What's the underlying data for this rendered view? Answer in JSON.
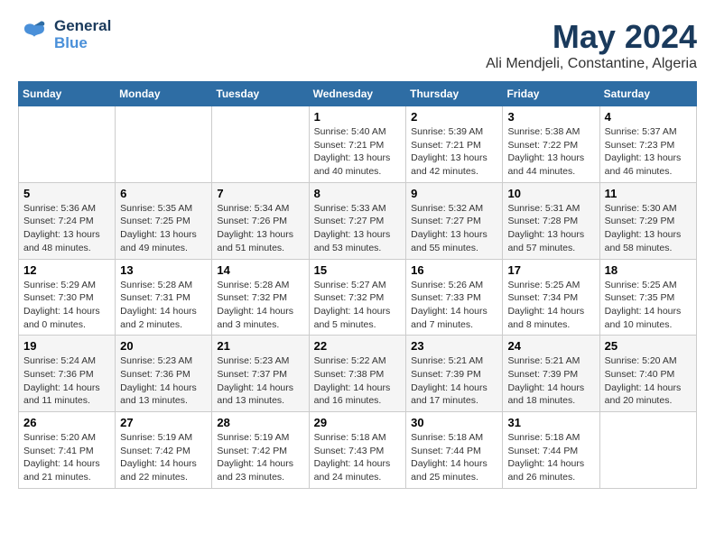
{
  "header": {
    "logo": {
      "general": "General",
      "blue": "Blue"
    },
    "month": "May 2024",
    "location": "Ali Mendjeli, Constantine, Algeria"
  },
  "weekdays": [
    "Sunday",
    "Monday",
    "Tuesday",
    "Wednesday",
    "Thursday",
    "Friday",
    "Saturday"
  ],
  "weeks": [
    [
      {
        "day": "",
        "info": ""
      },
      {
        "day": "",
        "info": ""
      },
      {
        "day": "",
        "info": ""
      },
      {
        "day": "1",
        "info": "Sunrise: 5:40 AM\nSunset: 7:21 PM\nDaylight: 13 hours\nand 40 minutes."
      },
      {
        "day": "2",
        "info": "Sunrise: 5:39 AM\nSunset: 7:21 PM\nDaylight: 13 hours\nand 42 minutes."
      },
      {
        "day": "3",
        "info": "Sunrise: 5:38 AM\nSunset: 7:22 PM\nDaylight: 13 hours\nand 44 minutes."
      },
      {
        "day": "4",
        "info": "Sunrise: 5:37 AM\nSunset: 7:23 PM\nDaylight: 13 hours\nand 46 minutes."
      }
    ],
    [
      {
        "day": "5",
        "info": "Sunrise: 5:36 AM\nSunset: 7:24 PM\nDaylight: 13 hours\nand 48 minutes."
      },
      {
        "day": "6",
        "info": "Sunrise: 5:35 AM\nSunset: 7:25 PM\nDaylight: 13 hours\nand 49 minutes."
      },
      {
        "day": "7",
        "info": "Sunrise: 5:34 AM\nSunset: 7:26 PM\nDaylight: 13 hours\nand 51 minutes."
      },
      {
        "day": "8",
        "info": "Sunrise: 5:33 AM\nSunset: 7:27 PM\nDaylight: 13 hours\nand 53 minutes."
      },
      {
        "day": "9",
        "info": "Sunrise: 5:32 AM\nSunset: 7:27 PM\nDaylight: 13 hours\nand 55 minutes."
      },
      {
        "day": "10",
        "info": "Sunrise: 5:31 AM\nSunset: 7:28 PM\nDaylight: 13 hours\nand 57 minutes."
      },
      {
        "day": "11",
        "info": "Sunrise: 5:30 AM\nSunset: 7:29 PM\nDaylight: 13 hours\nand 58 minutes."
      }
    ],
    [
      {
        "day": "12",
        "info": "Sunrise: 5:29 AM\nSunset: 7:30 PM\nDaylight: 14 hours\nand 0 minutes."
      },
      {
        "day": "13",
        "info": "Sunrise: 5:28 AM\nSunset: 7:31 PM\nDaylight: 14 hours\nand 2 minutes."
      },
      {
        "day": "14",
        "info": "Sunrise: 5:28 AM\nSunset: 7:32 PM\nDaylight: 14 hours\nand 3 minutes."
      },
      {
        "day": "15",
        "info": "Sunrise: 5:27 AM\nSunset: 7:32 PM\nDaylight: 14 hours\nand 5 minutes."
      },
      {
        "day": "16",
        "info": "Sunrise: 5:26 AM\nSunset: 7:33 PM\nDaylight: 14 hours\nand 7 minutes."
      },
      {
        "day": "17",
        "info": "Sunrise: 5:25 AM\nSunset: 7:34 PM\nDaylight: 14 hours\nand 8 minutes."
      },
      {
        "day": "18",
        "info": "Sunrise: 5:25 AM\nSunset: 7:35 PM\nDaylight: 14 hours\nand 10 minutes."
      }
    ],
    [
      {
        "day": "19",
        "info": "Sunrise: 5:24 AM\nSunset: 7:36 PM\nDaylight: 14 hours\nand 11 minutes."
      },
      {
        "day": "20",
        "info": "Sunrise: 5:23 AM\nSunset: 7:36 PM\nDaylight: 14 hours\nand 13 minutes."
      },
      {
        "day": "21",
        "info": "Sunrise: 5:23 AM\nSunset: 7:37 PM\nDaylight: 14 hours\nand 13 minutes."
      },
      {
        "day": "22",
        "info": "Sunrise: 5:22 AM\nSunset: 7:38 PM\nDaylight: 14 hours\nand 16 minutes."
      },
      {
        "day": "23",
        "info": "Sunrise: 5:21 AM\nSunset: 7:39 PM\nDaylight: 14 hours\nand 17 minutes."
      },
      {
        "day": "24",
        "info": "Sunrise: 5:21 AM\nSunset: 7:39 PM\nDaylight: 14 hours\nand 18 minutes."
      },
      {
        "day": "25",
        "info": "Sunrise: 5:20 AM\nSunset: 7:40 PM\nDaylight: 14 hours\nand 20 minutes."
      }
    ],
    [
      {
        "day": "26",
        "info": "Sunrise: 5:20 AM\nSunset: 7:41 PM\nDaylight: 14 hours\nand 21 minutes."
      },
      {
        "day": "27",
        "info": "Sunrise: 5:19 AM\nSunset: 7:42 PM\nDaylight: 14 hours\nand 22 minutes."
      },
      {
        "day": "28",
        "info": "Sunrise: 5:19 AM\nSunset: 7:42 PM\nDaylight: 14 hours\nand 23 minutes."
      },
      {
        "day": "29",
        "info": "Sunrise: 5:18 AM\nSunset: 7:43 PM\nDaylight: 14 hours\nand 24 minutes."
      },
      {
        "day": "30",
        "info": "Sunrise: 5:18 AM\nSunset: 7:44 PM\nDaylight: 14 hours\nand 25 minutes."
      },
      {
        "day": "31",
        "info": "Sunrise: 5:18 AM\nSunset: 7:44 PM\nDaylight: 14 hours\nand 26 minutes."
      },
      {
        "day": "",
        "info": ""
      }
    ]
  ]
}
